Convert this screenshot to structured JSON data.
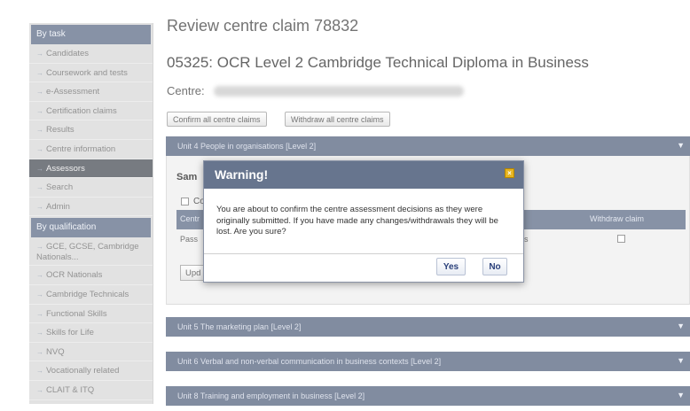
{
  "sidebar": {
    "by_task_heading": "By task",
    "task_items": [
      {
        "label": "Candidates"
      },
      {
        "label": "Coursework and tests"
      },
      {
        "label": "e-Assessment"
      },
      {
        "label": "Certification claims"
      },
      {
        "label": "Results"
      },
      {
        "label": "Centre information"
      },
      {
        "label": "Assessors"
      },
      {
        "label": "Search"
      },
      {
        "label": "Admin"
      }
    ],
    "by_qualification_heading": "By qualification",
    "qual_items": [
      {
        "label": "GCE, GCSE, Cambridge Nationals..."
      },
      {
        "label": "OCR Nationals"
      },
      {
        "label": "Cambridge Technicals"
      },
      {
        "label": "Functional Skills"
      },
      {
        "label": "Skills for Life"
      },
      {
        "label": "NVQ"
      },
      {
        "label": "Vocationally related"
      },
      {
        "label": "CLAIT & ITQ"
      }
    ]
  },
  "main": {
    "title": "Review centre claim 78832",
    "subtitle": "05325: OCR Level 2 Cambridge Technical Diploma in Business",
    "centre_label": "Centre:",
    "confirm_all_button": "Confirm all centre claims",
    "withdraw_all_button": "Withdraw all centre claims",
    "units": [
      {
        "label": "Unit 4 People in organisations [Level 2]"
      },
      {
        "label": "Unit 5 The marketing plan [Level 2]"
      },
      {
        "label": "Unit 6 Verbal and non-verbal communication in business contexts [Level 2]"
      },
      {
        "label": "Unit 8 Training and employment in business [Level 2]"
      }
    ],
    "sample_label": "Sam",
    "checkbox_label": "Co",
    "table": {
      "col1_header": "Centr",
      "col_withdraw_header": "Withdraw claim",
      "row1_col1": "Pass",
      "row1_col3": "s"
    },
    "update_button": "Upd"
  },
  "dialog": {
    "title": "Warning!",
    "message": "You are about to confirm the centre assessment decisions as they were originally submitted. If you have made any changes/withdrawals they will be lost. Are you sure?",
    "yes_button": "Yes",
    "no_button": "No"
  }
}
